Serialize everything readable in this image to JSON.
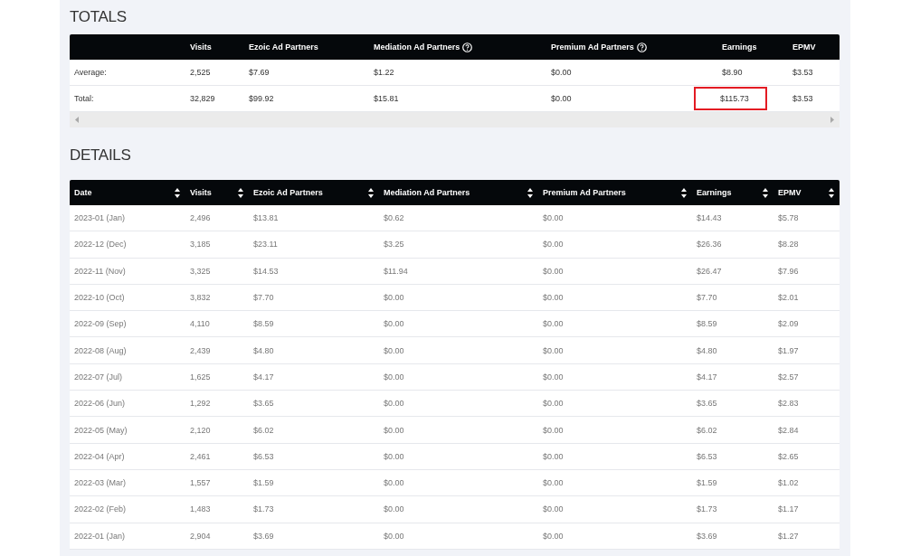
{
  "totals": {
    "title": "TOTALS",
    "columns": [
      {
        "kind": "blank"
      },
      {
        "label": "Visits",
        "kind": "plain"
      },
      {
        "label": "Ezoic Ad Partners",
        "kind": "plain"
      },
      {
        "label": "Mediation Ad Partners",
        "kind": "help"
      },
      {
        "label": "Premium Ad Partners",
        "kind": "help"
      },
      {
        "label": "Earnings",
        "kind": "plain"
      },
      {
        "label": "EPMV",
        "kind": "plain"
      }
    ],
    "rows": [
      {
        "cells": [
          {
            "text": "Average:",
            "highlighted": false
          },
          {
            "text": "2,525",
            "highlighted": false
          },
          {
            "text": "$7.69",
            "highlighted": false
          },
          {
            "text": "$1.22",
            "highlighted": false
          },
          {
            "text": "$0.00",
            "highlighted": false
          },
          {
            "text": "$8.90",
            "highlighted": false
          },
          {
            "text": "$3.53",
            "highlighted": false
          }
        ]
      },
      {
        "cells": [
          {
            "text": "Total:",
            "highlighted": false
          },
          {
            "text": "32,829",
            "highlighted": false
          },
          {
            "text": "$99.92",
            "highlighted": false
          },
          {
            "text": "$15.81",
            "highlighted": false
          },
          {
            "text": "$0.00",
            "highlighted": false
          },
          {
            "text": "$115.73",
            "highlighted": true
          },
          {
            "text": "$3.53",
            "highlighted": false
          }
        ]
      }
    ]
  },
  "details": {
    "title": "DETAILS",
    "columns": [
      "Date",
      "Visits",
      "Ezoic Ad Partners",
      "Mediation Ad Partners",
      "Premium Ad Partners",
      "Earnings",
      "EPMV"
    ],
    "rows": [
      [
        "2023-01 (Jan)",
        "2,496",
        "$13.81",
        "$0.62",
        "$0.00",
        "$14.43",
        "$5.78"
      ],
      [
        "2022-12 (Dec)",
        "3,185",
        "$23.11",
        "$3.25",
        "$0.00",
        "$26.36",
        "$8.28"
      ],
      [
        "2022-11 (Nov)",
        "3,325",
        "$14.53",
        "$11.94",
        "$0.00",
        "$26.47",
        "$7.96"
      ],
      [
        "2022-10 (Oct)",
        "3,832",
        "$7.70",
        "$0.00",
        "$0.00",
        "$7.70",
        "$2.01"
      ],
      [
        "2022-09 (Sep)",
        "4,110",
        "$8.59",
        "$0.00",
        "$0.00",
        "$8.59",
        "$2.09"
      ],
      [
        "2022-08 (Aug)",
        "2,439",
        "$4.80",
        "$0.00",
        "$0.00",
        "$4.80",
        "$1.97"
      ],
      [
        "2022-07 (Jul)",
        "1,625",
        "$4.17",
        "$0.00",
        "$0.00",
        "$4.17",
        "$2.57"
      ],
      [
        "2022-06 (Jun)",
        "1,292",
        "$3.65",
        "$0.00",
        "$0.00",
        "$3.65",
        "$2.83"
      ],
      [
        "2022-05 (May)",
        "2,120",
        "$6.02",
        "$0.00",
        "$0.00",
        "$6.02",
        "$2.84"
      ],
      [
        "2022-04 (Apr)",
        "2,461",
        "$6.53",
        "$0.00",
        "$0.00",
        "$6.53",
        "$2.65"
      ],
      [
        "2022-03 (Mar)",
        "1,557",
        "$1.59",
        "$0.00",
        "$0.00",
        "$1.59",
        "$1.02"
      ],
      [
        "2022-02 (Feb)",
        "1,483",
        "$1.73",
        "$0.00",
        "$0.00",
        "$1.73",
        "$1.17"
      ],
      [
        "2022-01 (Jan)",
        "2,904",
        "$3.69",
        "$0.00",
        "$0.00",
        "$3.69",
        "$1.27"
      ]
    ]
  }
}
